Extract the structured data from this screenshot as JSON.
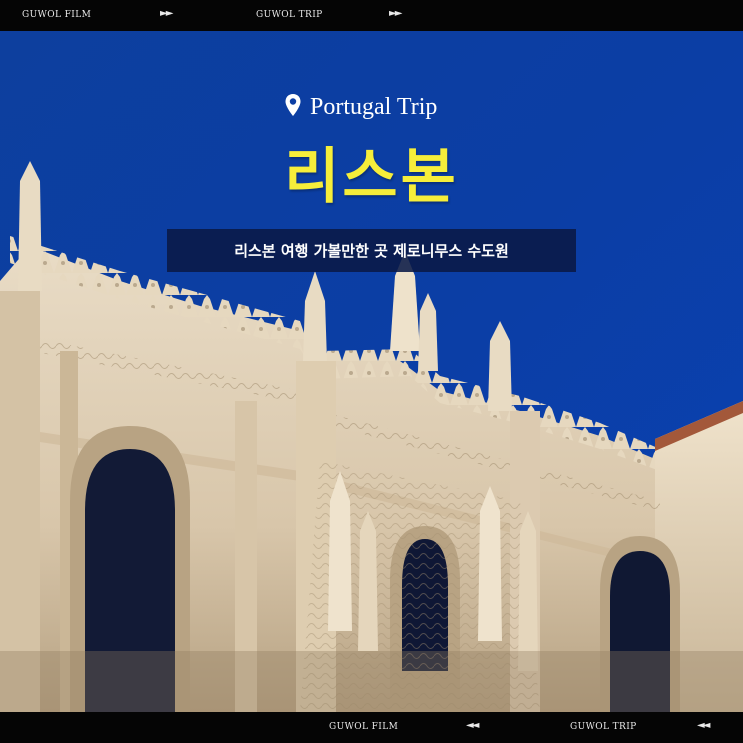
{
  "top_bar": {
    "label_1": "GUWOL FILM",
    "arrow_1": "►►",
    "label_2": "GUWOL TRIP",
    "arrow_2": "►►"
  },
  "bottom_bar": {
    "label_1": "GUWOL FILM",
    "arrow_1": "◄◄",
    "label_2": "GUWOL TRIP",
    "arrow_2": "◄◄"
  },
  "header": {
    "location_icon": "map-pin-icon",
    "location_text": "Portugal Trip",
    "title": "리스본",
    "subtitle": "리스본 여행 가볼만한 곳  제로니무스 수도원"
  },
  "colors": {
    "sky": "#0b3ea5",
    "title": "#f6ee3a",
    "subtitle_bg": "#0a1946",
    "stone": "#e4d4bb"
  }
}
